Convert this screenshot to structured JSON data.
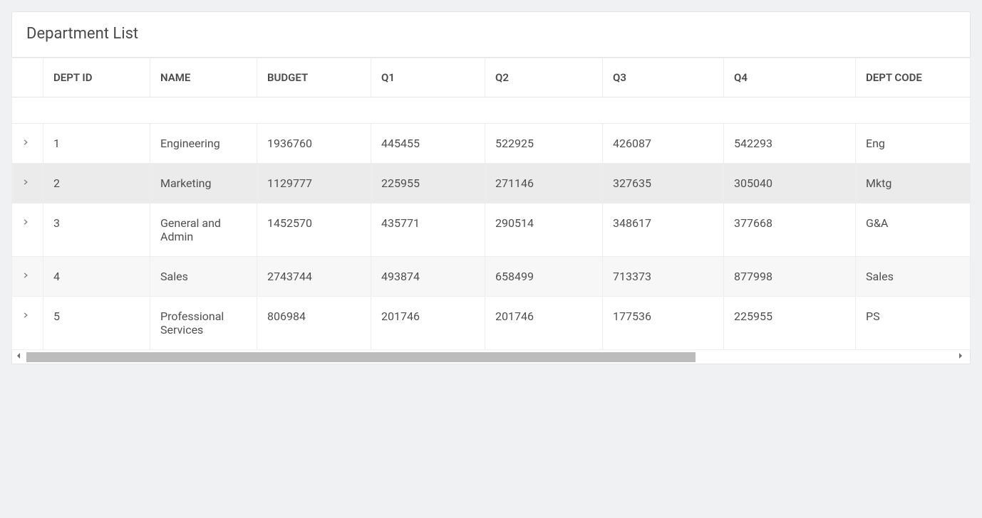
{
  "page": {
    "title": "Department List"
  },
  "table": {
    "columns": {
      "dept_id": "DEPT ID",
      "name": "NAME",
      "budget": "BUDGET",
      "q1": "Q1",
      "q2": "Q2",
      "q3": "Q3",
      "q4": "Q4",
      "dept_code": "DEPT CODE"
    },
    "rows": [
      {
        "dept_id": "1",
        "name": "Engineering",
        "budget": "1936760",
        "q1": "445455",
        "q2": "522925",
        "q3": "426087",
        "q4": "542293",
        "dept_code": "Eng"
      },
      {
        "dept_id": "2",
        "name": "Marketing",
        "budget": "1129777",
        "q1": "225955",
        "q2": "271146",
        "q3": "327635",
        "q4": "305040",
        "dept_code": "Mktg"
      },
      {
        "dept_id": "3",
        "name": "General and Admin",
        "budget": "1452570",
        "q1": "435771",
        "q2": "290514",
        "q3": "348617",
        "q4": "377668",
        "dept_code": "G&A"
      },
      {
        "dept_id": "4",
        "name": "Sales",
        "budget": "2743744",
        "q1": "493874",
        "q2": "658499",
        "q3": "713373",
        "q4": "877998",
        "dept_code": "Sales"
      },
      {
        "dept_id": "5",
        "name": "Professional Services",
        "budget": "806984",
        "q1": "201746",
        "q2": "201746",
        "q3": "177536",
        "q4": "225955",
        "dept_code": "PS"
      }
    ]
  },
  "hovered_row_index": 1
}
